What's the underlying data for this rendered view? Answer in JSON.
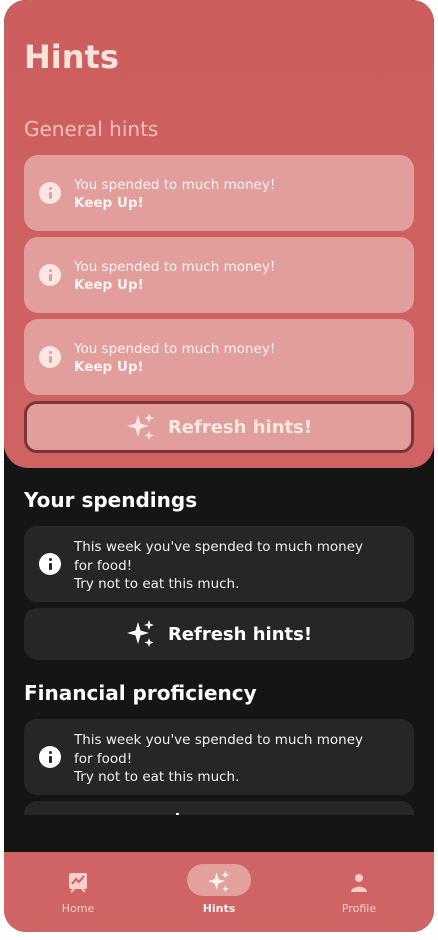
{
  "header": {
    "title": "Hints"
  },
  "general_hints": {
    "heading": "General hints",
    "items": [
      {
        "line1": "You spended to much money!",
        "line2": "Keep Up!",
        "icon": "info-icon"
      },
      {
        "line1": "You spended to much money!",
        "line2": "Keep Up!",
        "icon": "info-icon"
      },
      {
        "line1": "You spended to much money!",
        "line2": "Keep Up!",
        "icon": "info-icon"
      }
    ],
    "refresh_label": "Refresh hints!"
  },
  "spendings": {
    "heading": "Your spendings",
    "card": {
      "lines": [
        "This week you've spended to much money",
        "for food!",
        "Try not to eat this much."
      ],
      "icon": "info-icon"
    },
    "refresh_label": "Refresh hints!"
  },
  "financial": {
    "heading": "Financial proficiency",
    "card": {
      "lines": [
        "This week you've spended to much money",
        "for food!",
        "Try not to eat this much."
      ],
      "icon": "info-icon"
    }
  },
  "nav": {
    "items": [
      {
        "label": "Home",
        "icon": "chart-icon",
        "active": false
      },
      {
        "label": "Hints",
        "icon": "sparkles-icon",
        "active": true
      },
      {
        "label": "Profile",
        "icon": "person-icon",
        "active": false
      }
    ]
  },
  "colors": {
    "accent": "#d06262",
    "card_light": "#e29e9c",
    "dark_bg": "#151515",
    "dark_card": "#262626"
  }
}
